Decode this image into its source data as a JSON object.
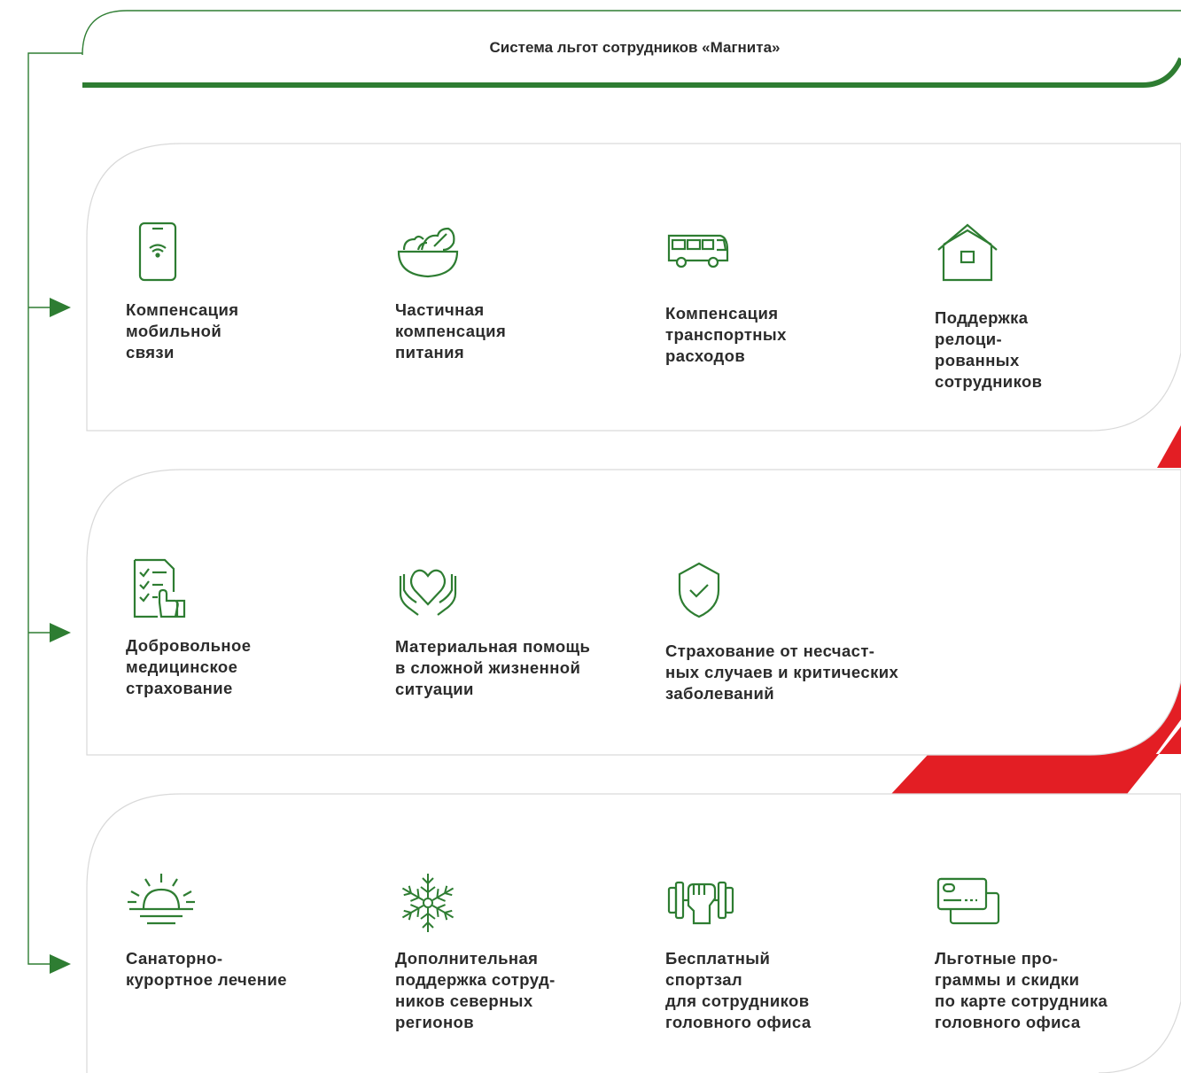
{
  "header": {
    "title": "Система льгот сотрудников «Магнита»"
  },
  "colors": {
    "green": "#2e7d32",
    "red": "#e31e24",
    "border": "#d9d9d9",
    "text": "#2b2b2b"
  },
  "groups": [
    {
      "items": [
        {
          "label": "Компенсация\nмобильной\nсвязи",
          "icon": "smartphone-wifi-icon"
        },
        {
          "label": "Частичная\nкомпенсация\nпитания",
          "icon": "salad-bowl-icon"
        },
        {
          "label": "Компенсация\nтранспортных\nрасходов",
          "icon": "bus-icon"
        },
        {
          "label": "Поддержка\nрелоци-\nрованных\nсотрудников",
          "icon": "house-icon"
        }
      ]
    },
    {
      "items": [
        {
          "label": "Добровольное\nмедицинское\nстрахование",
          "icon": "medical-checklist-icon"
        },
        {
          "label": "Материальная помощь\nв сложной жизненной\nситуации",
          "icon": "hands-heart-icon"
        },
        {
          "label": "Страхование от несчаст-\nных случаев и критических\nзаболеваний",
          "icon": "shield-check-icon"
        }
      ]
    },
    {
      "items": [
        {
          "label": "Санаторно-\nкурортное лечение",
          "icon": "sunrise-icon"
        },
        {
          "label": "Дополнительная\nподдержка сотруд-\nников северных\nрегионов",
          "icon": "snowflake-icon"
        },
        {
          "label": "Бесплатный\nспортзал\nдля сотрудников\nголовного офиса",
          "icon": "dumbbell-fist-icon"
        },
        {
          "label": "Льготные про-\nграммы и скидки\nпо карте сотрудника\nголовного офиса",
          "icon": "discount-card-icon"
        }
      ]
    }
  ]
}
